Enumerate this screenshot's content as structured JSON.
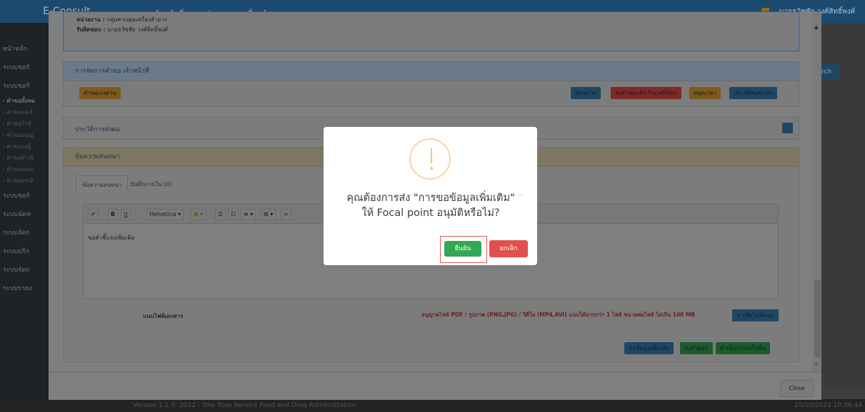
{
  "app": {
    "brand": "E-Consult",
    "top_nav": "≡  เจ้าหน้าที่ อย. กลุ่มควบคุมเครื่องสำอาง",
    "user_name": "นายธวัชชัย วงศ์สิทธิ์พงศ์",
    "search_btn": "rch",
    "version": "Version 1.2 © 2022 - One Stop Service Food and Drug Administration",
    "datetime": "20/10/2022 10:38:44"
  },
  "sidebar": {
    "items": [
      {
        "label": "หน้าหลัก"
      },
      {
        "label": "ระบบขอรั"
      },
      {
        "label": "ระบบขอรั"
      },
      {
        "label": "- คำขอทั้งหม"
      },
      {
        "label": "- คำขอรอเจ้"
      },
      {
        "label": "- คำขอกำลั"
      },
      {
        "label": "- คำขออนุญ"
      },
      {
        "label": "- คำขอรอผู้"
      },
      {
        "label": "- คำขอดำเนิ"
      },
      {
        "label": "- คำขอหมดเ"
      },
      {
        "label": "- คำขอยกเลิ"
      },
      {
        "label": "ระบบขอรั"
      },
      {
        "label": "ระบบนัดห"
      },
      {
        "label": "ระบบจัดก"
      },
      {
        "label": "ระบบบริก"
      },
      {
        "label": "ระบบจัดก"
      },
      {
        "label": "ระบบรายง"
      }
    ]
  },
  "info": {
    "unit_label": "หน่วยงาน :",
    "unit_value": "กลุ่มควบคุมเครื่องสำอาง",
    "owner_label": "รับผิดชอบ :",
    "owner_value": "นายธวัชชัย วงศ์สิทธิ์พงศ์"
  },
  "manage": {
    "header": "การจัดการคำขอ เจ้าหน้าที่",
    "urgent_btn": "คำขอเร่งด่วน",
    "appoint_btn": "นัดหมาย",
    "return_focal_btn": "ส่งคำขอกลับ FocalPoint",
    "pause_btn": "หยุดเวลา",
    "pause_history_btn": "ประวัติหยุดเวลา"
  },
  "history": {
    "header": "ประวัติการส่งต่อ"
  },
  "chat": {
    "header": "ข้อความสนทนา",
    "tab_chat": "ข้อความสนทนา",
    "tab_internal": "บันทึกภายใน (0)",
    "toolbar": {
      "font": "Helvetica ▾",
      "bold": "B",
      "underline": "U",
      "eraser": "✐"
    },
    "editor_text": "ขอคำชี้แจงเพิ่มเติม"
  },
  "attach": {
    "label": "แนบไฟล์เอกสาร",
    "hint": "อนุญาตไฟล์ PDF / รูปภาพ (PNG,JPG) / วิดีโอ (MP4,AVI) แนบได้มากกว่า 1 ไฟล์ ขนาดต่อไฟล์ ไม่เกิน 100 MB",
    "add_btn": "+ เพิ่มไฟล์แนบ"
  },
  "actions": {
    "more_info_btn": "ขอข้อมูลเพิ่มเติม",
    "send_reply_btn": "ส่งคำตอบ",
    "complete_btn": "ดำเนินการเสร็จสิ้น"
  },
  "modal": {
    "close_btn": "Close"
  },
  "dialog": {
    "message": "คุณต้องการส่ง \"การขอข้อมูลเพิ่มเติม\" ให้ Focal point อนุมัติหรือไม่?",
    "confirm": "ยืนยัน",
    "cancel": "ยกเลิก",
    "confirm_color": "#33a852",
    "cancel_color": "#e14f4f",
    "icon": "warning-icon"
  }
}
